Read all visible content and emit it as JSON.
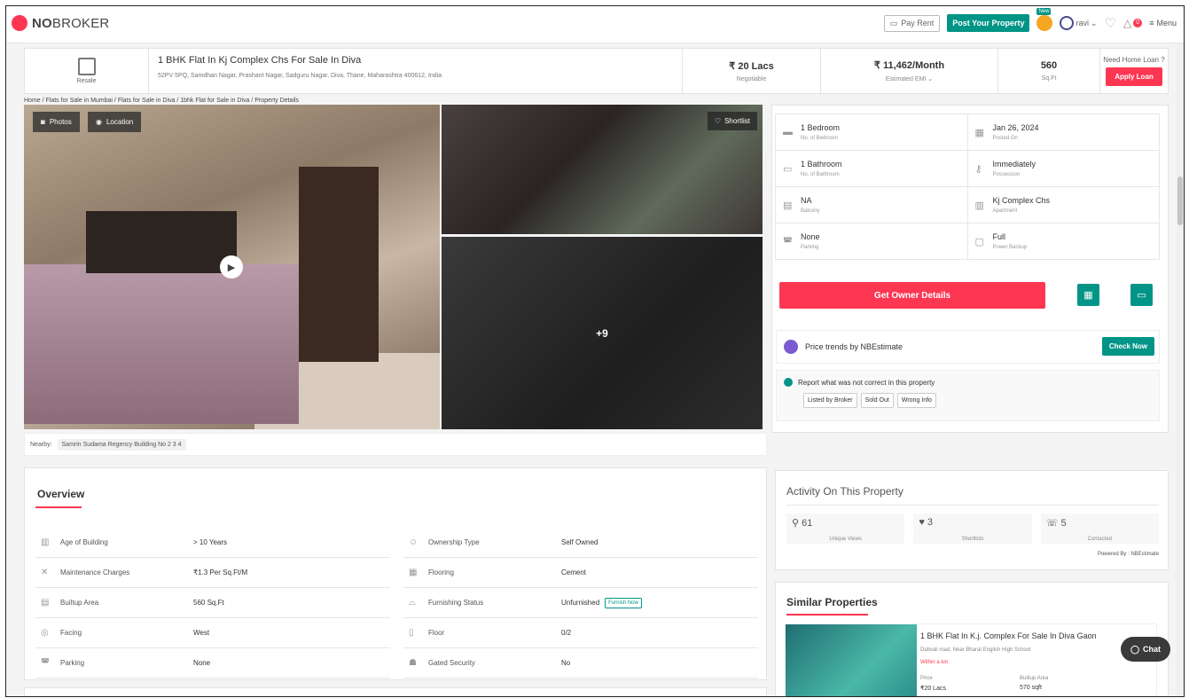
{
  "header": {
    "logo_bold": "NO",
    "logo_rest": "BROKER",
    "pay_rent": "Pay Rent",
    "post_property": "Post Your Property",
    "new_badge": "New",
    "user": "ravi",
    "notification_count": "0",
    "menu": "Menu"
  },
  "property": {
    "type": "Resale",
    "title": "1 BHK Flat In Kj Complex Chs For Sale In Diva",
    "address": "52PV 5PQ, Samdhan Nagar, Prashant Nagar, Sadguru Nagar, Diva, Thane, Maharashtra 400612, India",
    "price": "₹ 20 Lacs",
    "price_sub": "Negotiable",
    "emi": "₹ 11,462/Month",
    "emi_sub": "Estimated EMI",
    "area": "560",
    "area_sub": "Sq.Ft",
    "loan_question": "Need Home Loan ?",
    "apply_loan": "Apply Loan"
  },
  "breadcrumb": "Home / Flats for Sale in Mumbai / Flats for Sale in Diva / 1bhk Flat for Sale in Diva / Property Details",
  "gallery": {
    "photos": "Photos",
    "location": "Location",
    "shortlist": "Shortlist",
    "more_count": "+9"
  },
  "nearby": {
    "label": "Nearby:",
    "place": "Samrin Sudama Regency Building No 2 3 4"
  },
  "details": [
    {
      "value": "1 Bedroom",
      "label": "No. of Bedroom",
      "icon": "bed-icon"
    },
    {
      "value": "Jan 26, 2024",
      "label": "Posted On",
      "icon": "calendar-icon"
    },
    {
      "value": "1 Bathroom",
      "label": "No. of Bathroom",
      "icon": "bath-icon"
    },
    {
      "value": "Immediately",
      "label": "Possession",
      "icon": "key-icon"
    },
    {
      "value": "NA",
      "label": "Balcony",
      "icon": "balcony-icon"
    },
    {
      "value": "Kj Complex Chs",
      "label": "Apartment",
      "icon": "building-icon"
    },
    {
      "value": "None",
      "label": "Parking",
      "icon": "car-icon"
    },
    {
      "value": "Full",
      "label": "Power Backup",
      "icon": "battery-icon"
    }
  ],
  "actions": {
    "get_owner": "Get Owner Details",
    "price_trends": "Price trends by NBEstimate",
    "check_now": "Check Now",
    "report_text": "Report what was not correct in this property",
    "report_options": [
      "Listed by Broker",
      "Sold Out",
      "Wrong Info"
    ]
  },
  "overview": {
    "title": "Overview",
    "rows": [
      {
        "key": "Age of Building",
        "value": "> 10 Years"
      },
      {
        "key": "Ownership Type",
        "value": "Self Owned"
      },
      {
        "key": "Maintenance Charges",
        "value": "₹1.3 Per Sq.Ft/M"
      },
      {
        "key": "Flooring",
        "value": "Cement"
      },
      {
        "key": "Builtup Area",
        "value": "560 Sq.Ft"
      },
      {
        "key": "Furnishing Status",
        "value": "Unfurnished",
        "tag": "Furnish Now"
      },
      {
        "key": "Facing",
        "value": "West"
      },
      {
        "key": "Floor",
        "value": "0/2"
      },
      {
        "key": "Parking",
        "value": "None"
      },
      {
        "key": "Gated Security",
        "value": "No"
      }
    ]
  },
  "activity": {
    "title": "Activity On This Property",
    "stats": [
      {
        "count": "61",
        "label": "Unique Views"
      },
      {
        "count": "3",
        "label": "Shortlists"
      },
      {
        "count": "5",
        "label": "Contacted"
      }
    ],
    "powered": "Powered By : NBEstimate"
  },
  "similar": {
    "title": "Similar Properties",
    "name": "1 BHK Flat In K.j. Complex For Sale In Diva Gaon",
    "address": "Dativali road, Near Bharat English High School",
    "distance": "Within a km",
    "price_label": "Price",
    "price": "₹20 Lacs",
    "area_label": "Builtup Area",
    "area": "570 sqft"
  },
  "chat": "Chat",
  "colors": {
    "brand_red": "#fd3752",
    "teal": "#009587"
  }
}
